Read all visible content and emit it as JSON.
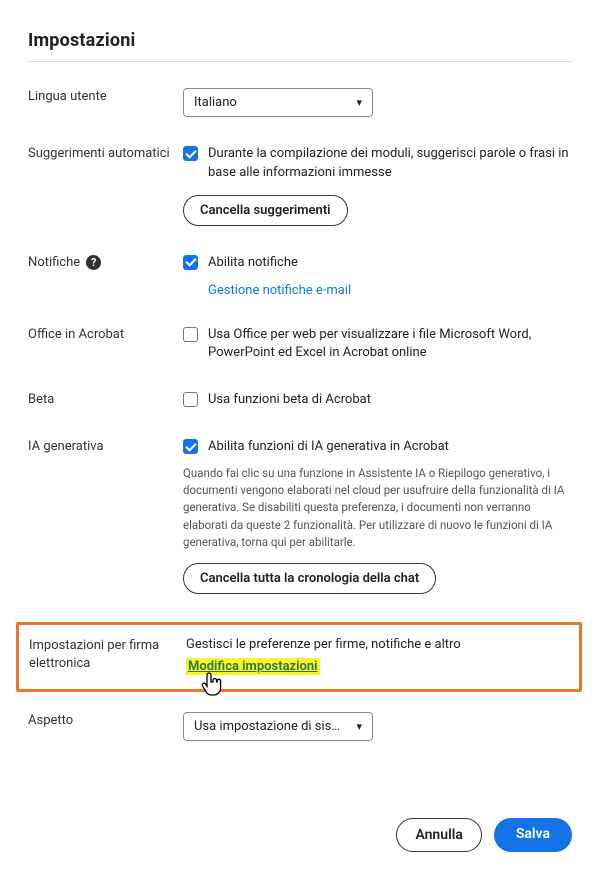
{
  "title": "Impostazioni",
  "language": {
    "label": "Lingua utente",
    "value": "Italiano"
  },
  "suggestions": {
    "label": "Suggerimenti automatici",
    "text": "Durante la compilazione dei moduli, suggerisci parole o frasi in base alle informazioni immesse",
    "button": "Cancella suggerimenti"
  },
  "notifications": {
    "label": "Notifiche",
    "text": "Abilita notifiche",
    "link": "Gestione notifiche e-mail"
  },
  "office": {
    "label": "Office in Acrobat",
    "text": "Usa Office per web per visualizzare i file Microsoft Word, PowerPoint ed Excel in Acrobat online"
  },
  "beta": {
    "label": "Beta",
    "text": "Usa funzioni beta di Acrobat"
  },
  "ai": {
    "label": "IA generativa",
    "text": "Abilita funzioni di IA generativa in Acrobat",
    "desc": "Quando fai clic su una funzione in Assistente IA o Riepilogo generativo, i documenti vengono elaborati nel cloud per usufruire della funzionalità di IA generativa. Se disabiliti questa preferenza, i documenti non verranno elaborati da queste 2 funzionalità. Per utilizzare di nuovo le funzioni di IA generativa, torna qui per abilitarle.",
    "button": "Cancella tutta la cronologia della chat"
  },
  "esign": {
    "label": "Impostazioni per firma elettronica",
    "text": "Gestisci le preferenze per firme, notifiche e altro",
    "link": "Modifica impostazioni"
  },
  "appearance": {
    "label": "Aspetto",
    "value": "Usa impostazione di sis…"
  },
  "footer": {
    "cancel": "Annulla",
    "save": "Salva"
  }
}
